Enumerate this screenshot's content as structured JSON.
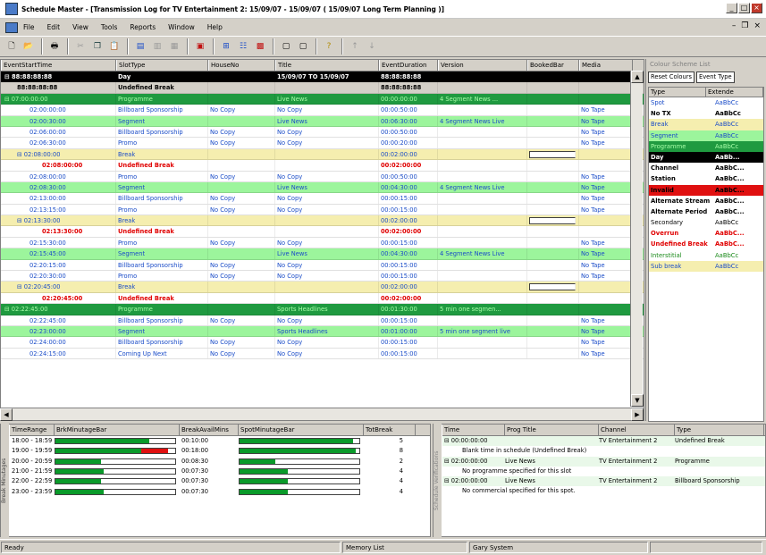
{
  "window": {
    "title": "Schedule Master - [Transmission Log for TV Entertainment 2: 15/09/07 - 15/09/07 ( 15/09/07 Long Term Planning )]"
  },
  "menu": [
    "File",
    "Edit",
    "View",
    "Tools",
    "Reports",
    "Window",
    "Help"
  ],
  "grid": {
    "columns": [
      "EventStartTime",
      "SlotType",
      "HouseNo",
      "Title",
      "EventDuration",
      "Version",
      "BookedBar",
      "Media"
    ],
    "rows": [
      {
        "style": "t-black",
        "c": [
          "88:88:88:88",
          "Day",
          "",
          "15/09/07 TO 15/09/07",
          "88:88:88:88",
          "",
          "",
          ""
        ],
        "lvl": 0
      },
      {
        "style": "t-gray",
        "c": [
          "88:88:88:88",
          "Undefined Break",
          "",
          "",
          "88:88:88:88",
          "",
          "",
          ""
        ],
        "lvl": 1
      },
      {
        "style": "t-prog",
        "c": [
          "07:00:00:00",
          "Programme",
          "",
          "Live News",
          "00:00:00:00",
          "4 Segment News ...",
          "",
          ""
        ],
        "lvl": 0
      },
      {
        "style": "t-spot",
        "c": [
          "02:00:00:00",
          "Billboard Sponsorship",
          "No Copy",
          "No Copy",
          "00:00:50:00",
          "",
          "",
          "No Tape"
        ],
        "lvl": 2
      },
      {
        "style": "t-seg",
        "c": [
          "02:00:30:00",
          "Segment",
          "",
          "Live News",
          "00:06:30:00",
          "4 Segment News Live",
          "",
          "No Tape"
        ],
        "lvl": 2
      },
      {
        "style": "t-spot",
        "c": [
          "02:06:00:00",
          "Billboard Sponsorship",
          "No Copy",
          "No Copy",
          "00:00:50:00",
          "",
          "",
          "No Tape"
        ],
        "lvl": 2
      },
      {
        "style": "t-spot",
        "c": [
          "02:06:30:00",
          "Promo",
          "No Copy",
          "No Copy",
          "00:00:20:00",
          "",
          "",
          "No Tape"
        ],
        "lvl": 2
      },
      {
        "style": "t-brk",
        "c": [
          "02:08:00:00",
          "Break",
          "",
          "",
          "00:02:00:00",
          "",
          "box",
          ""
        ],
        "lvl": 1
      },
      {
        "style": "t-und",
        "c": [
          "02:08:00:00",
          "Undefined Break",
          "",
          "",
          "00:02:00:00",
          "",
          "",
          ""
        ],
        "lvl": 3
      },
      {
        "style": "t-spot",
        "c": [
          "02:08:00:00",
          "Promo",
          "No Copy",
          "No Copy",
          "00:00:50:00",
          "",
          "",
          "No Tape"
        ],
        "lvl": 2
      },
      {
        "style": "t-seg",
        "c": [
          "02:08:30:00",
          "Segment",
          "",
          "Live News",
          "00:04:30:00",
          "4 Segment News Live",
          "",
          "No Tape"
        ],
        "lvl": 2
      },
      {
        "style": "t-spot",
        "c": [
          "02:13:00:00",
          "Billboard Sponsorship",
          "No Copy",
          "No Copy",
          "00:00:15:00",
          "",
          "",
          "No Tape"
        ],
        "lvl": 2
      },
      {
        "style": "t-spot",
        "c": [
          "02:13:15:00",
          "Promo",
          "No Copy",
          "No Copy",
          "00:00:15:00",
          "",
          "",
          "No Tape"
        ],
        "lvl": 2
      },
      {
        "style": "t-brk",
        "c": [
          "02:13:30:00",
          "Break",
          "",
          "",
          "00:02:00:00",
          "",
          "box",
          ""
        ],
        "lvl": 1
      },
      {
        "style": "t-und",
        "c": [
          "02:13:30:00",
          "Undefined Break",
          "",
          "",
          "00:02:00:00",
          "",
          "",
          ""
        ],
        "lvl": 3
      },
      {
        "style": "t-spot",
        "c": [
          "02:15:30:00",
          "Promo",
          "No Copy",
          "No Copy",
          "00:00:15:00",
          "",
          "",
          "No Tape"
        ],
        "lvl": 2
      },
      {
        "style": "t-seg",
        "c": [
          "02:15:45:00",
          "Segment",
          "",
          "Live News",
          "00:04:30:00",
          "4 Segment News Live",
          "",
          "No Tape"
        ],
        "lvl": 2
      },
      {
        "style": "t-spot",
        "c": [
          "02:20:15:00",
          "Billboard Sponsorship",
          "No Copy",
          "No Copy",
          "00:00:15:00",
          "",
          "",
          "No Tape"
        ],
        "lvl": 2
      },
      {
        "style": "t-spot",
        "c": [
          "02:20:30:00",
          "Promo",
          "No Copy",
          "No Copy",
          "00:00:15:00",
          "",
          "",
          "No Tape"
        ],
        "lvl": 2
      },
      {
        "style": "t-brk",
        "c": [
          "02:20:45:00",
          "Break",
          "",
          "",
          "00:02:00:00",
          "",
          "box",
          ""
        ],
        "lvl": 1
      },
      {
        "style": "t-und",
        "c": [
          "02:20:45:00",
          "Undefined Break",
          "",
          "",
          "00:02:00:00",
          "",
          "",
          ""
        ],
        "lvl": 3
      },
      {
        "style": "t-prog",
        "c": [
          "02:22:45:00",
          "Programme",
          "",
          "Sports Headlines",
          "00:01:30:00",
          "5 min one segmen...",
          "",
          ""
        ],
        "lvl": 0
      },
      {
        "style": "t-spot",
        "c": [
          "02:22:45:00",
          "Billboard Sponsorship",
          "No Copy",
          "No Copy",
          "00:00:15:00",
          "",
          "",
          "No Tape"
        ],
        "lvl": 2
      },
      {
        "style": "t-seg",
        "c": [
          "02:23:00:00",
          "Segment",
          "",
          "Sports Headlines",
          "00:01:00:00",
          "5 min one segment live",
          "",
          "No Tape"
        ],
        "lvl": 2
      },
      {
        "style": "t-spot",
        "c": [
          "02:24:00:00",
          "Billboard Sponsorship",
          "No Copy",
          "No Copy",
          "00:00:15:00",
          "",
          "",
          "No Tape"
        ],
        "lvl": 2
      },
      {
        "style": "t-spot",
        "c": [
          "02:24:15:00",
          "Coming Up Next",
          "No Copy",
          "No Copy",
          "00:00:15:00",
          "",
          "",
          "No Tape"
        ],
        "lvl": 2
      }
    ]
  },
  "colour_scheme": {
    "panel_title": "Colour Scheme List",
    "reset_label": "Reset Colours",
    "dropdown_value": "Event Type",
    "headers": [
      "Type",
      "Extende"
    ],
    "items": [
      {
        "name": "Spot",
        "sample": "AaBbCc",
        "fg": "#1a4cc8",
        "bg": "#ffffff",
        "bold": false
      },
      {
        "name": "No TX",
        "sample": "AaBbCc",
        "fg": "#000000",
        "bg": "#ffffff",
        "bold": true
      },
      {
        "name": "Break",
        "sample": "AaBbCc",
        "fg": "#1a4cc8",
        "bg": "#f5eeaf",
        "bold": false
      },
      {
        "name": "Segment",
        "sample": "AaBbCc",
        "fg": "#1a4cc8",
        "bg": "#9cf59c",
        "bold": false
      },
      {
        "name": "Programme",
        "sample": "AaBbCc",
        "fg": "#a8ffa8",
        "bg": "#1f9a40",
        "bold": false
      },
      {
        "name": "Day",
        "sample": "AaBb...",
        "fg": "#ffffff",
        "bg": "#000000",
        "bold": true
      },
      {
        "name": "Channel",
        "sample": "AaBbC...",
        "fg": "#000000",
        "bg": "#ffffff",
        "bold": true
      },
      {
        "name": "Station",
        "sample": "AaBbC...",
        "fg": "#000000",
        "bg": "#ffffff",
        "bold": true
      },
      {
        "name": "Invalid",
        "sample": "AaBbC...",
        "fg": "#000000",
        "bg": "#e01010",
        "bold": true
      },
      {
        "name": "Alternate Stream",
        "sample": "AaBbC...",
        "fg": "#000000",
        "bg": "#ffffff",
        "bold": true
      },
      {
        "name": "Alternate Period",
        "sample": "AaBbC...",
        "fg": "#000000",
        "bg": "#ffffff",
        "bold": true
      },
      {
        "name": "Secondary",
        "sample": "AaBbCc",
        "fg": "#000000",
        "bg": "#ffffff",
        "bold": false
      },
      {
        "name": "Overrun",
        "sample": "AaBbC...",
        "fg": "#e00000",
        "bg": "#ffffff",
        "bold": true
      },
      {
        "name": "Undefined Break",
        "sample": "AaBbC...",
        "fg": "#e00000",
        "bg": "#ffffff",
        "bold": true
      },
      {
        "name": "Interstitial",
        "sample": "AaBbCc",
        "fg": "#1a8a1a",
        "bg": "#ffffff",
        "bold": false
      },
      {
        "name": "Sub break",
        "sample": "AaBbCc",
        "fg": "#1a4cc8",
        "bg": "#f5eeaf",
        "bold": false
      }
    ]
  },
  "break_pane": {
    "side_title": "Break Minutages",
    "headers": [
      "TimeRange",
      "BrkMinutageBar",
      "BreakAvailMins",
      "SpotMinutageBar",
      "TotBreak"
    ],
    "rows": [
      {
        "range": "18:00 - 18:59",
        "brk_fill": 0.78,
        "brk_over": 0,
        "avail": "00:10:00",
        "spot_fill": 0.95,
        "tot": "5"
      },
      {
        "range": "19:00 - 19:59",
        "brk_fill": 0.72,
        "brk_over": 0.22,
        "avail": "00:18:00",
        "spot_fill": 0.97,
        "tot": "8"
      },
      {
        "range": "20:00 - 20:59",
        "brk_fill": 0.38,
        "brk_over": 0,
        "avail": "00:08:30",
        "spot_fill": 0.3,
        "tot": "2"
      },
      {
        "range": "21:00 - 21:59",
        "brk_fill": 0.4,
        "brk_over": 0,
        "avail": "00:07:30",
        "spot_fill": 0.4,
        "tot": "4"
      },
      {
        "range": "22:00 - 22:59",
        "brk_fill": 0.38,
        "brk_over": 0,
        "avail": "00:07:30",
        "spot_fill": 0.4,
        "tot": "4"
      },
      {
        "range": "23:00 - 23:59",
        "brk_fill": 0.4,
        "brk_over": 0,
        "avail": "00:07:30",
        "spot_fill": 0.4,
        "tot": "4"
      }
    ]
  },
  "schedule_pane": {
    "side_title": "Schedule Verifications",
    "headers": [
      "Time",
      "Prog Title",
      "Channel",
      "Type"
    ],
    "rows": [
      {
        "kind": "main",
        "time": "00:00:00:00",
        "title": "",
        "channel": "TV Entertainment 2",
        "type": "Undefined Break"
      },
      {
        "kind": "sub",
        "text": "Blank time in schedule (Undefined Break)"
      },
      {
        "kind": "main",
        "time": "02:00:00:00",
        "title": "Live News",
        "channel": "TV Entertainment 2",
        "type": "Programme"
      },
      {
        "kind": "sub",
        "text": "No programme specified for this slot"
      },
      {
        "kind": "main",
        "time": "02:00:00:00",
        "title": "Live News",
        "channel": "TV Entertainment 2",
        "type": "Billboard Sponsorship"
      },
      {
        "kind": "sub",
        "text": "No commercial specified for this spot."
      }
    ]
  },
  "status": {
    "ready": "Ready",
    "memory": "Memory List",
    "user": "Gary System"
  }
}
